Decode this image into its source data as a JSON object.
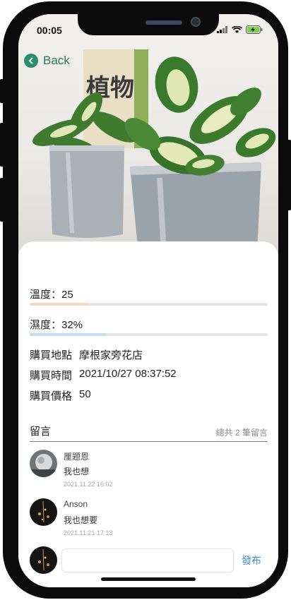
{
  "status_bar": {
    "time": "00:05"
  },
  "nav": {
    "back_label": "Back"
  },
  "photo": {
    "sign_text": "植物"
  },
  "metrics": {
    "temperature": {
      "label": "溫度：25",
      "fill_fraction": 0.25,
      "color": "#f5d9b8"
    },
    "humidity": {
      "label": "濕度：32%",
      "fill_fraction": 0.32,
      "color": "#c6dcef"
    }
  },
  "info": {
    "location": {
      "label": "購買地點",
      "value": "摩根家旁花店"
    },
    "time": {
      "label": "購買時間",
      "value": "2021/10/27 08:37:52"
    },
    "price": {
      "label": "購買價格",
      "value": "50"
    }
  },
  "comments": {
    "title": "留言",
    "count_text": "總共 2 筆留言",
    "items": [
      {
        "name": "厘題恩",
        "text": "我也想",
        "time": "2021.11.22 16:02"
      },
      {
        "name": "Anson",
        "text": "我也想要",
        "time": "2021.11.21 17:13"
      }
    ],
    "input_value": "",
    "post_label": "發布"
  },
  "colors": {
    "accent_green": "#2c8c6e",
    "link_blue": "#3a8fd0"
  }
}
